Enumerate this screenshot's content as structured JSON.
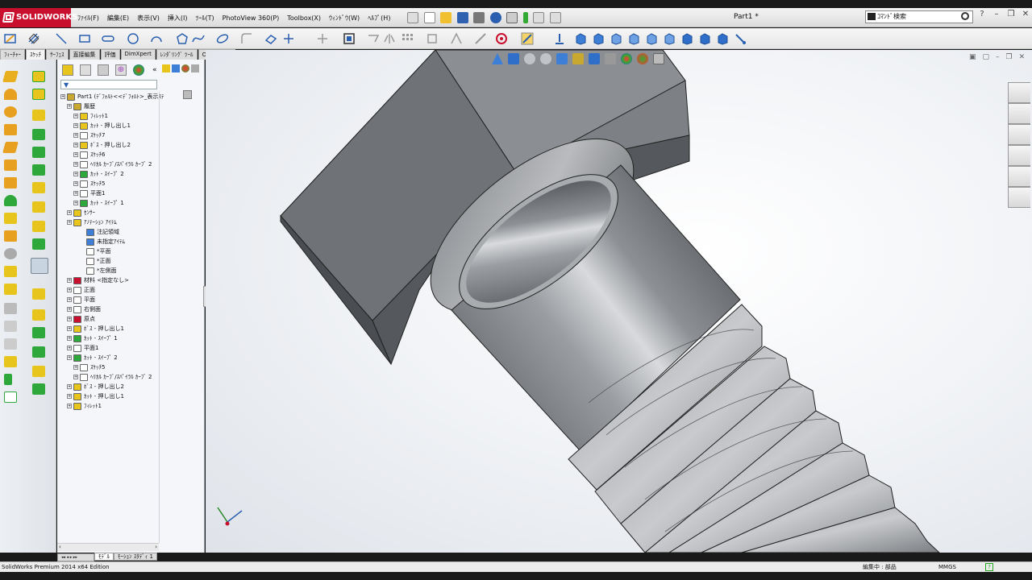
{
  "app": {
    "brand": "SOLIDWORKS",
    "document_title": "Part1 *",
    "search_placeholder": "ｺﾏﾝﾄﾞ検索"
  },
  "menu": [
    "ﾌｧｲﾙ(F)",
    "編集(E)",
    "表示(V)",
    "挿入(I)",
    "ﾂｰﾙ(T)",
    "PhotoView 360(P)",
    "Toolbox(X)",
    "ｳｨﾝﾄﾞｳ(W)",
    "ﾍﾙﾌﾟ(H)"
  ],
  "command_tabs": [
    {
      "label": "ﾌｨｰﾁｬｰ",
      "active": false
    },
    {
      "label": "ｽｹｯﾁ",
      "active": true
    },
    {
      "label": "ｻｰﾌｪｽ",
      "active": false
    },
    {
      "label": "直接編集",
      "active": false
    },
    {
      "label": "評価",
      "active": false
    },
    {
      "label": "DimXpert",
      "active": false
    },
    {
      "label": "ﾚﾝﾀﾞﾘﾝｸﾞ ﾂｰﾙ",
      "active": false
    },
    {
      "label": "Office 製品",
      "active": false
    }
  ],
  "tree": [
    {
      "label": "Part1 (ﾃﾞﾌｫﾙﾄ<<ﾃﾞﾌｫﾙﾄ>_表示ｽﾃ",
      "indent": 0,
      "icon": "part-icon"
    },
    {
      "label": "履歴",
      "indent": 1,
      "icon": "history-icon"
    },
    {
      "label": "ﾌｨﾚｯﾄ1",
      "indent": 2,
      "icon": "fillet-icon"
    },
    {
      "label": "ｶｯﾄ - 押し出し1",
      "indent": 2,
      "icon": "cut-extrude-icon"
    },
    {
      "label": "ｽｹｯﾁ7",
      "indent": 2,
      "icon": "sketch-icon"
    },
    {
      "label": "ﾎﾞｽ - 押し出し2",
      "indent": 2,
      "icon": "boss-extrude-icon"
    },
    {
      "label": "ｽｹｯﾁ6",
      "indent": 2,
      "icon": "sketch-icon"
    },
    {
      "label": "ﾍﾘｶﾙ ｶｰﾌﾞ/ｽﾊﾟｲﾗﾙ ｶｰﾌﾞ 2",
      "indent": 2,
      "icon": "helix-icon"
    },
    {
      "label": "ｶｯﾄ - ｽｲｰﾌﾟ 2",
      "indent": 2,
      "icon": "cut-sweep-icon"
    },
    {
      "label": "ｽｹｯﾁ5",
      "indent": 2,
      "icon": "sketch-icon"
    },
    {
      "label": "平面1",
      "indent": 2,
      "icon": "plane-icon"
    },
    {
      "label": "ｶｯﾄ - ｽｲｰﾌﾟ 1",
      "indent": 2,
      "icon": "cut-sweep-icon"
    },
    {
      "label": "ｾﾝｻｰ",
      "indent": 1,
      "icon": "sensor-icon"
    },
    {
      "label": "ｱﾉﾃｰｼｮﾝ ｱｲﾃﾑ",
      "indent": 1,
      "icon": "annotation-icon"
    },
    {
      "label": "注記領域",
      "indent": 3,
      "icon": "note-area-icon"
    },
    {
      "label": "未指定ｱｲﾃﾑ",
      "indent": 3,
      "icon": "unassigned-icon"
    },
    {
      "label": "*平面",
      "indent": 3,
      "icon": "plane-annot-icon"
    },
    {
      "label": "*正面",
      "indent": 3,
      "icon": "plane-annot-icon"
    },
    {
      "label": "*左側面",
      "indent": 3,
      "icon": "plane-annot-icon"
    },
    {
      "label": "材料 <指定なし>",
      "indent": 1,
      "icon": "material-icon"
    },
    {
      "label": "正面",
      "indent": 1,
      "icon": "plane-icon"
    },
    {
      "label": "平面",
      "indent": 1,
      "icon": "plane-icon"
    },
    {
      "label": "右側面",
      "indent": 1,
      "icon": "plane-icon"
    },
    {
      "label": "原点",
      "indent": 1,
      "icon": "origin-icon"
    },
    {
      "label": "ﾎﾞｽ - 押し出し1",
      "indent": 1,
      "icon": "boss-extrude-icon"
    },
    {
      "label": "ｶｯﾄ - ｽｲｰﾌﾟ 1",
      "indent": 1,
      "icon": "cut-sweep-icon"
    },
    {
      "label": "平面1",
      "indent": 1,
      "icon": "plane-icon"
    },
    {
      "label": "ｶｯﾄ - ｽｲｰﾌﾟ 2",
      "indent": 1,
      "icon": "cut-sweep-icon"
    },
    {
      "label": "ｽｹｯﾁ5",
      "indent": 2,
      "icon": "sketch-icon"
    },
    {
      "label": "ﾍﾘｶﾙ ｶｰﾌﾞ/ｽﾊﾟｲﾗﾙ ｶｰﾌﾞ 2",
      "indent": 2,
      "icon": "helix-icon"
    },
    {
      "label": "ﾎﾞｽ - 押し出し2",
      "indent": 1,
      "icon": "boss-extrude-icon"
    },
    {
      "label": "ｶｯﾄ - 押し出し1",
      "indent": 1,
      "icon": "cut-extrude-icon"
    },
    {
      "label": "ﾌｨﾚｯﾄ1",
      "indent": 1,
      "icon": "fillet-icon"
    }
  ],
  "bottom_tabs": [
    "ﾓﾃﾞﾙ",
    "ﾓｰｼｮﾝ ｽﾀﾃﾞｨ 1"
  ],
  "status": {
    "edition": "SolidWorks Premium 2014 x64 Edition",
    "editing": "編集中 : 部品",
    "units": "MMGS",
    "help": "?"
  },
  "colors": {
    "brand_red": "#c8102e",
    "part_gray": "#808387",
    "viewport_bg": "#f2f4f7",
    "feature_yellow": "#e8c51c",
    "feature_green": "#2ea83a"
  }
}
